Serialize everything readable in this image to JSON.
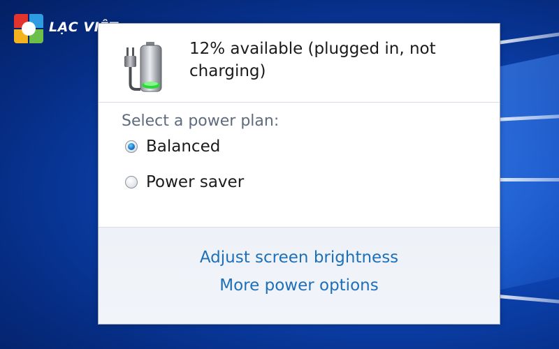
{
  "brand": {
    "name": "LẠC VIỆT",
    "logo_colors": [
      "#e2332d",
      "#2f9be0",
      "#f4b21e",
      "#6cc04a"
    ]
  },
  "popup": {
    "battery_icon": "battery-plugged-icon",
    "status_line1": "12% available (plugged in, not",
    "status_line2": "charging)",
    "plan_heading": "Select a power plan:",
    "plans": [
      {
        "label": "Balanced",
        "selected": true
      },
      {
        "label": "Power saver",
        "selected": false
      }
    ],
    "links": [
      "Adjust screen brightness",
      "More power options"
    ]
  },
  "colors": {
    "link": "#1e6fb8",
    "heading": "#5e6b7e",
    "desktop": "#0d46b6"
  }
}
